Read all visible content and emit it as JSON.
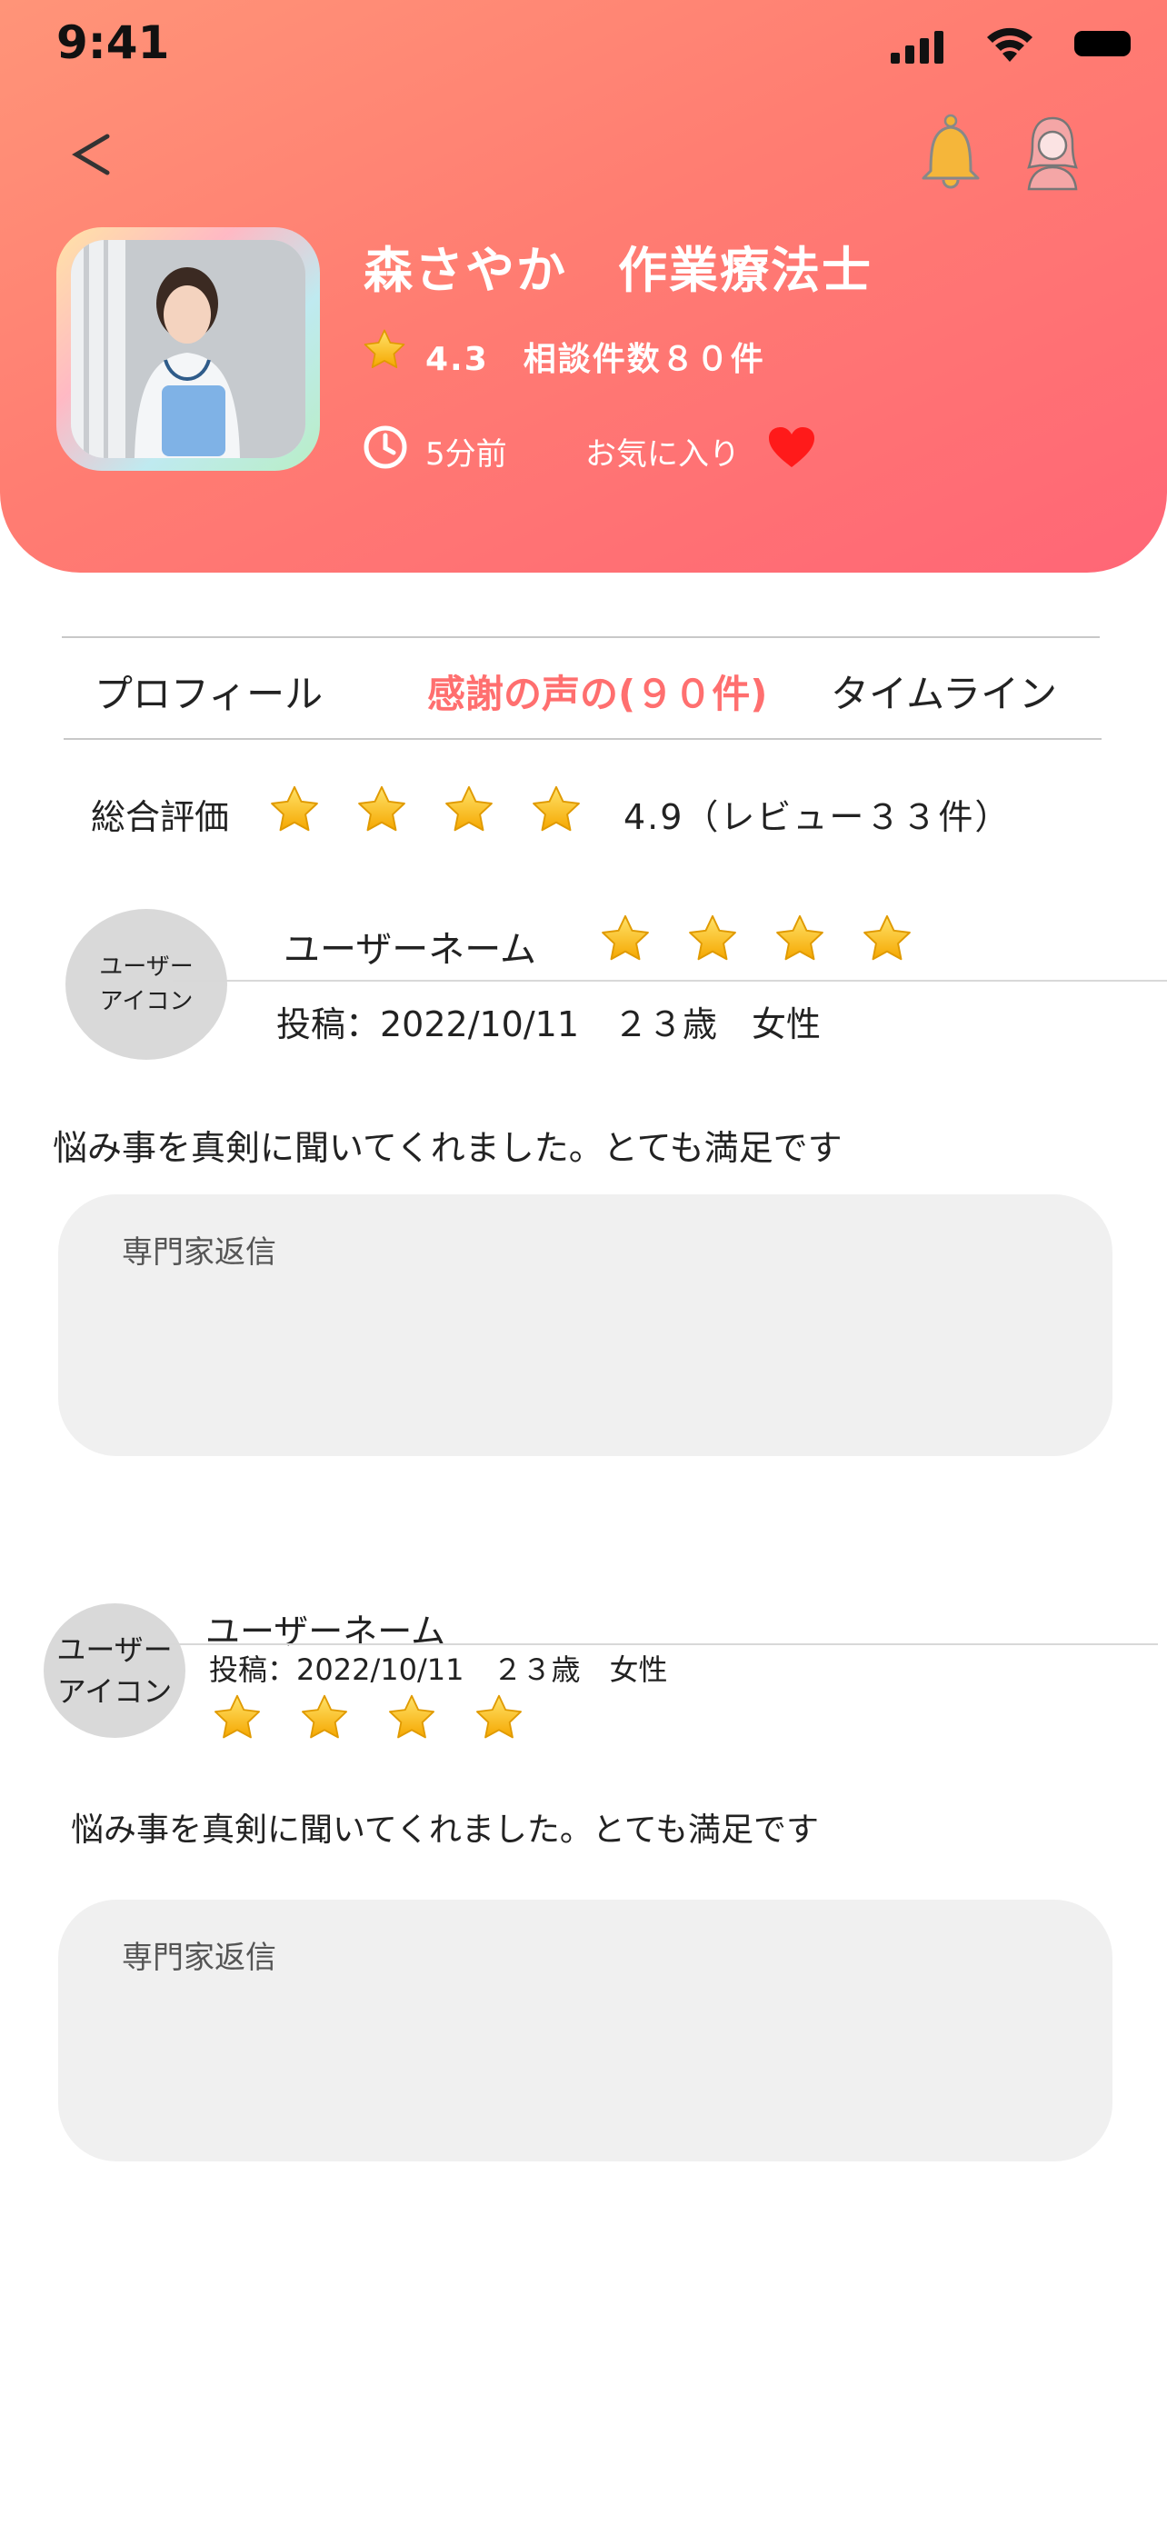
{
  "status_bar": {
    "time": "9:41"
  },
  "header": {
    "name": "森さやか　作業療法士",
    "rating_text": "4.3　相談件数８０件",
    "last_seen": "5分前",
    "favorite_label": "お気に入り"
  },
  "tabs": [
    {
      "label": "プロフィール"
    },
    {
      "label": "感謝の声の(９０件)"
    },
    {
      "label": "タイムライン"
    }
  ],
  "active_tab": 1,
  "summary": {
    "label": "総合評価",
    "stars": 4,
    "value_text": "4.9（レビュー３３件）"
  },
  "reviews": [
    {
      "avatar_line1": "ユーザー",
      "avatar_line2": "アイコン",
      "username": "ユーザーネーム",
      "meta": "投稿：2022/10/11　２３歳　女性",
      "stars": 4,
      "body": "悩み事を真剣に聞いてくれました。とても満足です",
      "reply_label": "専門家返信"
    },
    {
      "avatar_line1": "ユーザー",
      "avatar_line2": "アイコン",
      "username": "ユーザーネーム",
      "meta": "投稿：2022/10/11　２３歳　女性",
      "stars": 4,
      "body": "悩み事を真剣に聞いてくれました。とても満足です",
      "reply_label": "専門家返信"
    }
  ],
  "colors": {
    "header_gradient_start": "#ff9478",
    "header_gradient_end": "#ff6676",
    "active_tab": "#ff6f6f",
    "heart": "#ff1a1a",
    "star": "#ffc21a",
    "reply_bg": "#f0f0f0",
    "avatar_bg": "#d9d9d9"
  },
  "icons": {
    "back": "chevron-left-icon",
    "notification": "bell-icon",
    "account": "user-avatar-icon",
    "rating": "star-icon",
    "time": "clock-icon",
    "favorite": "heart-icon"
  }
}
